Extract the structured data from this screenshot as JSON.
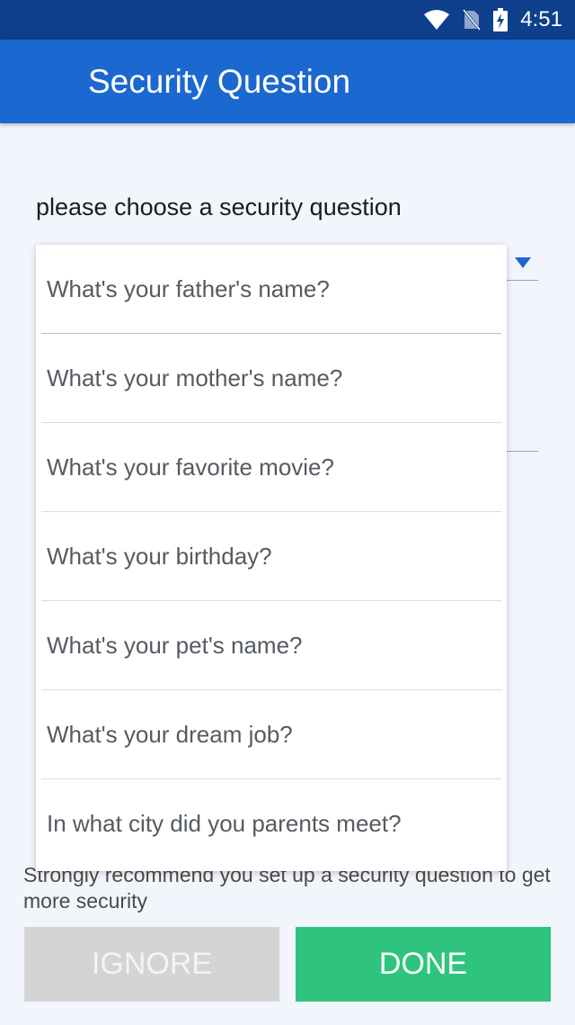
{
  "status_bar": {
    "time": "4:51",
    "icons": [
      "wifi-icon",
      "no-sim-icon",
      "battery-charging-icon"
    ]
  },
  "app_bar": {
    "title": "Security Question"
  },
  "form": {
    "prompt": "please choose a security question"
  },
  "dropdown": {
    "options": [
      "What's your father's name?",
      "What's your mother's name?",
      "What's your favorite movie?",
      "What's your birthday?",
      "What's your pet's name?",
      "What's your dream job?",
      "In what city did you parents meet?"
    ]
  },
  "hint": {
    "text": "Strongly recommend you set up a security question to get more security"
  },
  "buttons": {
    "ignore_label": "IGNORE",
    "done_label": "DONE"
  },
  "colors": {
    "status_bar": "#0d3f8c",
    "app_bar": "#1b68d0",
    "accent": "#1b68d0",
    "done": "#2fc47d",
    "ignore": "#d4d4d4",
    "background": "#f2f6fc"
  }
}
